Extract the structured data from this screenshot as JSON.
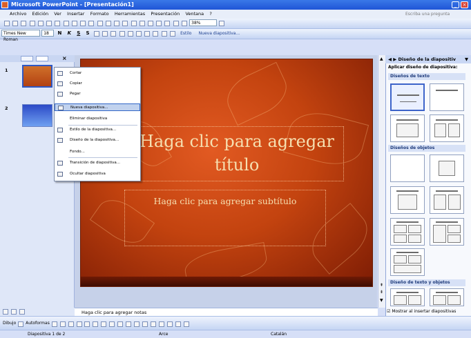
{
  "window": {
    "title": "Microsoft PowerPoint - [Presentación1]",
    "help_placeholder": "Escriba una pregunta"
  },
  "menu": [
    "Archivo",
    "Edición",
    "Ver",
    "Insertar",
    "Formato",
    "Herramientas",
    "Presentación",
    "Ventana",
    "?"
  ],
  "toolbar": {
    "zoom": "38%",
    "font_name": "Times New Roman",
    "font_size": "18",
    "bold": "N",
    "italic": "K",
    "underline": "S",
    "shadow": "S",
    "design_label": "Estilo",
    "new_slide_label": "Nueva diapositiva..."
  },
  "slides_pane": {
    "numbers": [
      "1",
      "2"
    ]
  },
  "context_menu": {
    "items": [
      "Cortar",
      "Copiar",
      "Pegar",
      "Nueva diapositiva...",
      "Eliminar diapositiva",
      "Estilo de la diapositiva...",
      "Diseño de la diapositiva...",
      "Fondo...",
      "Transición de diapositiva...",
      "Ocultar diapositiva"
    ],
    "highlighted_index": 3
  },
  "slide": {
    "title_placeholder": "Haga clic para agregar título",
    "subtitle_placeholder": "Haga clic para agregar subtítulo",
    "colors": {
      "base": "#c3430f",
      "text": "#f6dfb0"
    }
  },
  "notes": {
    "placeholder": "Haga clic para agregar notas"
  },
  "task_pane": {
    "title": "Diseño de la diapositiv",
    "apply_label": "Aplicar diseño de diapositiva:",
    "sections": [
      "Diseños de texto",
      "Diseños de objetos",
      "Diseño de texto y objetos"
    ],
    "show_on_insert_label": "Mostrar al insertar diapositivas"
  },
  "drawing_toolbar": {
    "draw_label": "Dibujo",
    "autoshapes_label": "Autoformas"
  },
  "status_bar": {
    "slide_info": "Diapositiva 1 de 2",
    "design": "Arce",
    "language": "Catalán"
  }
}
